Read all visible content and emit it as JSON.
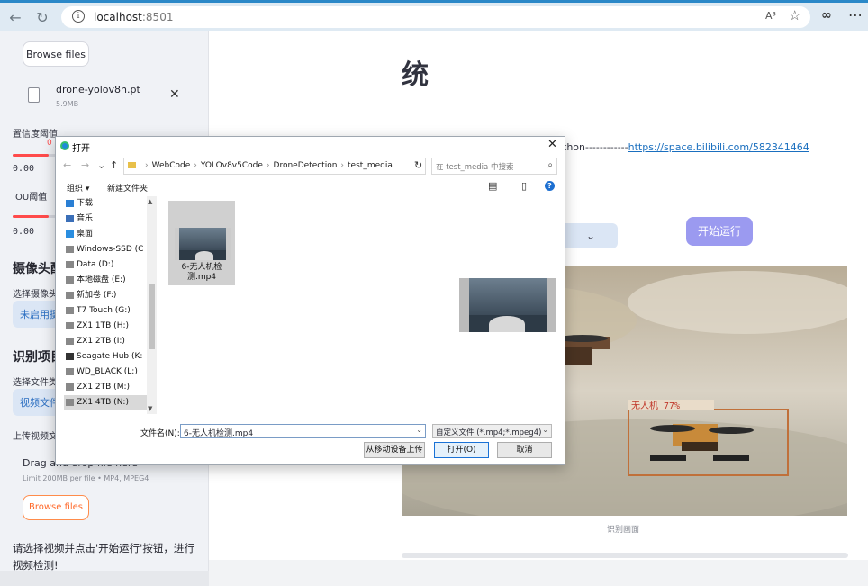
{
  "browser": {
    "back_icon": "←",
    "reload_icon": "↻",
    "info_icon": "i",
    "url_host": "localhost",
    "url_port": ":8501",
    "read_aloud": "A³",
    "favorite_icon": "☆",
    "ext_icon": "∞",
    "menu_icon": "⋯"
  },
  "sidebar": {
    "browse_top": "Browse files",
    "uploaded_file": {
      "name": "drone-yolov8n.pt",
      "size": "5.9MB",
      "remove": "✕"
    },
    "conf_label": "置信度阈值",
    "conf_current": "0",
    "conf_fill": 0.2,
    "conf_min": "0.00",
    "iou_label": "IOU阈值",
    "iou_fill": 0.2,
    "iou_min": "0.00",
    "camera_header": "摄像头配置",
    "camera_select_label": "选择摄像头",
    "camera_select_value": "未启用摄像头",
    "recognition_header": "识别项目设置",
    "file_type_label": "选择文件类型",
    "file_type_value": "视频文件",
    "upload_label": "上传视频文件",
    "drag_text": "Drag and drop file here",
    "limit_text": "Limit 200MB per file • MP4, MPEG4",
    "browse_bottom": "Browse files",
    "hint": "请选择视频并点击'开始运行'按钮，进行视频检测!"
  },
  "main": {
    "title": "统",
    "author_text": "thon------------",
    "author_link": "https://space.bilibili.com/582341464",
    "select_arrow": "⌄",
    "run_button": "开始运行",
    "detection_label": "无人机 77%",
    "frame_caption": "识别画面"
  },
  "dialog": {
    "title": "打开",
    "close": "✕",
    "nav_back": "←",
    "nav_forward": "→",
    "nav_down": "⌄",
    "nav_up": "↑",
    "path": [
      "WebCode",
      "YOLOv8v5Code",
      "DroneDetection",
      "test_media"
    ],
    "refresh": "↻",
    "search_placeholder": "在 test_media 中搜索",
    "search_icon": "⌕",
    "organize": "组织 ▾",
    "new_folder": "新建文件夹",
    "view_icon": "▤",
    "pane_icon": "▯",
    "help": "?",
    "tree": [
      "下载",
      "音乐",
      "桌面",
      "Windows-SSD (C",
      "Data (D:)",
      "本地磁盘 (E:)",
      "新加卷 (F:)",
      "T7 Touch (G:)",
      "ZX1 1TB (H:)",
      "ZX1 2TB (I:)",
      "Seagate Hub (K:",
      "WD_BLACK (L:)",
      "ZX1 2TB (M:)",
      "ZX1 4TB (N:)"
    ],
    "file_tile_name": "6-无人机检测.mp4",
    "filename_label": "文件名(N):",
    "filename_value": "6-无人机检测.mp4",
    "filter_value": "自定义文件 (*.mp4;*.mpeg4)",
    "dropdown": "⌄",
    "btn_mobile": "从移动设备上传",
    "btn_open": "打开(O)",
    "btn_cancel": "取消",
    "scroll_up": "▲",
    "scroll_down": "▼"
  },
  "colors": {
    "accent": "#ff4b4b",
    "run_button": "#9b9af0",
    "link": "#1a6fbf",
    "detection_box": "#c0703a"
  }
}
